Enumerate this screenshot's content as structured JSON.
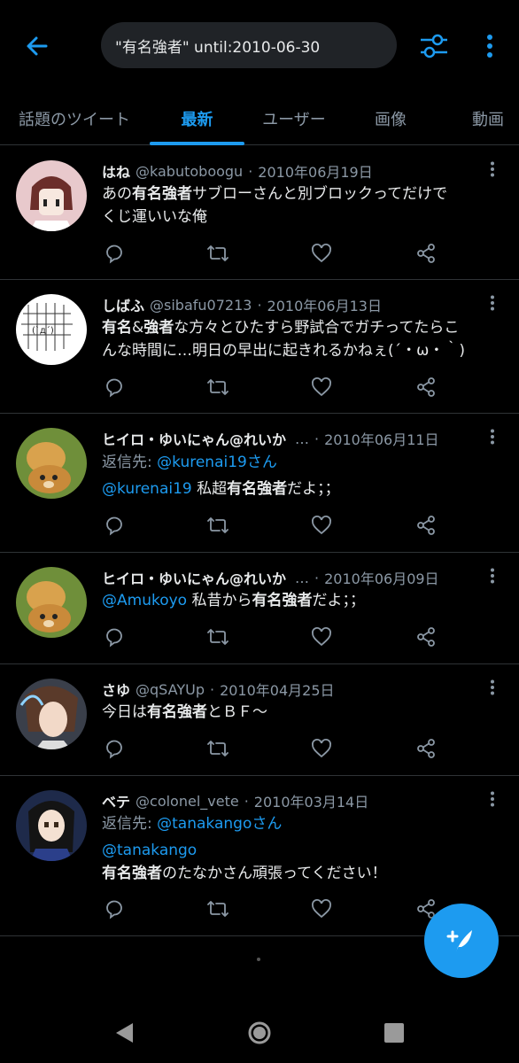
{
  "search": {
    "query": "\"有名強者\" until:2010-06-30"
  },
  "tabs": [
    {
      "label": "話題のツイート"
    },
    {
      "label": "最新"
    },
    {
      "label": "ユーザー"
    },
    {
      "label": "画像"
    },
    {
      "label": "動画"
    }
  ],
  "tweets": [
    {
      "name": "はね",
      "handle": "@kabutoboogu",
      "date": "2010年06月19日",
      "lines": [
        {
          "a": "あの",
          "b": "有名強者",
          "c": "サブローさんと別ブロックってだけで"
        },
        {
          "a": "くじ運いいな俺"
        }
      ]
    },
    {
      "name": "しばふ",
      "handle": "@sibafu07213",
      "date": "2010年06月13日",
      "lines": [
        {
          "b1": "有名",
          "a": "&",
          "b2": "強者",
          "c": "な方々とひたすら野試合でガチってたらこ"
        },
        {
          "a": "んな時間に…明日の早出に起きれるかねぇ(´・ω・｀)"
        }
      ]
    },
    {
      "name": "ヒイロ・ゆいにゃん@れいか",
      "ellipsis": "…",
      "date": "2010年06月11日",
      "reply_prefix": "返信先: ",
      "reply_to": "@kurenai19さん",
      "lines": [
        {
          "mention": "@kurenai19",
          "a": " 私超",
          "b": "有名強者",
          "c": "だよ；；"
        }
      ]
    },
    {
      "name": "ヒイロ・ゆいにゃん@れいか",
      "ellipsis": "…",
      "date": "2010年06月09日",
      "lines": [
        {
          "mention": "@Amukoyo",
          "a": " 私昔から",
          "b": "有名強者",
          "c": "だよ；；"
        }
      ]
    },
    {
      "name": "さゆ",
      "handle": "@qSAYUp",
      "date": "2010年04月25日",
      "lines": [
        {
          "a": "今日は",
          "b": "有名強者",
          "c": "とＢＦ〜"
        }
      ]
    },
    {
      "name": "ベテ",
      "handle": "@colonel_vete",
      "date": "2010年03月14日",
      "reply_prefix": "返信先: ",
      "reply_to": "@tanakangoさん",
      "lines": [
        {
          "mention": "@tanakango"
        },
        {
          "b": "有名強者",
          "c": "のたなかさん頑張ってください！"
        }
      ]
    }
  ],
  "separator": "·",
  "colors": {
    "accent": "#1d9bf0",
    "background": "#000000",
    "muted": "#8b98a5",
    "text": "#e7e9ea"
  },
  "icons": [
    "back-arrow-icon",
    "filter-icon",
    "more-vertical-icon",
    "reply-icon",
    "retweet-icon",
    "like-icon",
    "share-icon",
    "compose-icon",
    "nav-back-icon",
    "nav-home-icon",
    "nav-recents-icon"
  ]
}
